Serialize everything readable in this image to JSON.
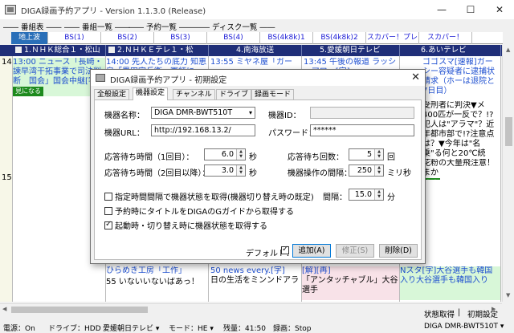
{
  "window": {
    "title": "DIGA録画予約アプリ - Version 1.1.3.0 (Release)",
    "minimize": "—",
    "maximize": "☐",
    "close": "✕"
  },
  "menu": [
    "―― 番組表 ――",
    "―― 番組一覧 ――",
    "―― 予約一覧 ――",
    "―― ディスク一覧 ――"
  ],
  "channel_tabs": [
    "地上波",
    "BS(1)",
    "BS(2)",
    "BS(3)",
    "BS(4)",
    "BS(4k8k)1",
    "BS(4k8k)2",
    "スカパー！プレ",
    "スカパー！"
  ],
  "channels": [
    "1.ＮＨＫ総合１・松山",
    "2.ＮＨＫＥテレ１・松",
    "4.南海放送",
    "5.愛媛朝日テレビ",
    "6.あいテレビ"
  ],
  "hours": [
    "14",
    "15"
  ],
  "programs": {
    "c1a": "13:00 ニュース「長崎・諫早湾干拓事業で司法判断　国会」国会中継[字]",
    "c1_badge": "見になる",
    "c2a": "14:00 先人たちの底力 知恵泉「黒田官兵衛、軍師に」",
    "c3a": "13:55 ミヤネ屋「ガー",
    "c4a": "13:45 午後の報道 ラッシュアワー[字]",
    "c5a": "ゴゴスマ[速報]ガーシー容疑者に逮捕状請求（ホーは退院と7日目）",
    "c5b": "受刑者に判決▼メ400匹が一反で？!?犯人は\"アラマ\"？近年都市部で!?注意点は？▼今年は\"名乗\"る何と20℃続",
    "c5c": "花粉の大量飛注意！まか",
    "c5_badge": "みる",
    "c2b": "ひらめき工房「工作」",
    "c2c": "55 いないいないばあっ！",
    "c3b": "50 news every.[字]",
    "c3c": "日の生活をミンンドアラ",
    "c4b": "[解][再]",
    "c4c": "「アンタッチャブル」大谷選手",
    "c5d": "Nスタ[字]大谷選手も韓国入り大谷選手も韓国入り"
  },
  "statusline": {
    "get_state": "状態取得",
    "sep": "|",
    "init_settings": "初期設定"
  },
  "statusbar": {
    "power": "電源：On",
    "drive": "ドライブ：HDD",
    "channel": "愛媛朝日テレビ",
    "mode": "モード：HE",
    "remain": "残量：41:50",
    "recording": "録画：Stop",
    "device": "DIGA DMR-BWT510T"
  },
  "dialog": {
    "title": "DIGA録画予約アプリ - 初期設定",
    "tabs": [
      "全般設定",
      "機器設定",
      "チャンネル",
      "ドライブ",
      "録画モード"
    ],
    "device_name_label": "機器名称：",
    "device_name_value": "DIGA DMR-BWT510T",
    "device_id_label": "機器ID：",
    "device_id_value": "",
    "device_url_label": "機器URL：",
    "device_url_value": "http://192.168.13.2/",
    "password_label": "パスワード：",
    "password_value": "******",
    "wait1_label": "応答待ち時間（1回目）：",
    "wait1_value": "6.0",
    "wait1_unit": "秒",
    "waitn_label": "応答待ち時間（2回目以降）：",
    "waitn_value": "3.0",
    "waitn_unit": "秒",
    "wait_count_label": "応答待ち回数：",
    "wait_count_value": "5",
    "wait_count_unit": "回",
    "op_interval_label": "機器操作の間隔：",
    "op_interval_value": "250",
    "op_interval_unit": "ミリ秒",
    "chk_periodic": "指定時間間隔で機器状態を取得(機器切り替え時の既定)",
    "interval_label": "間隔：",
    "interval_value": "15.0",
    "interval_unit": "分",
    "chk_title": "予約時にタイトルをDIGAのGガイドから取得する",
    "chk_startup": "起動時・切り替え時に機器状態を取得する",
    "default_label": "デフォルト：",
    "add_button": "追加(A)",
    "edit_button": "修正(S)",
    "delete_button": "削除(D)",
    "close": "✕"
  },
  "state": {
    "chk_periodic": false,
    "chk_title": false,
    "chk_startup": true,
    "default_checked": true
  },
  "colors": {
    "channel_header": "#1f2e78",
    "active_tab": "#2a6fb8",
    "link_blue": "#1e4fd0",
    "recorded_green": "#d8f7d8",
    "recorded_pink": "#f8e2e8"
  }
}
